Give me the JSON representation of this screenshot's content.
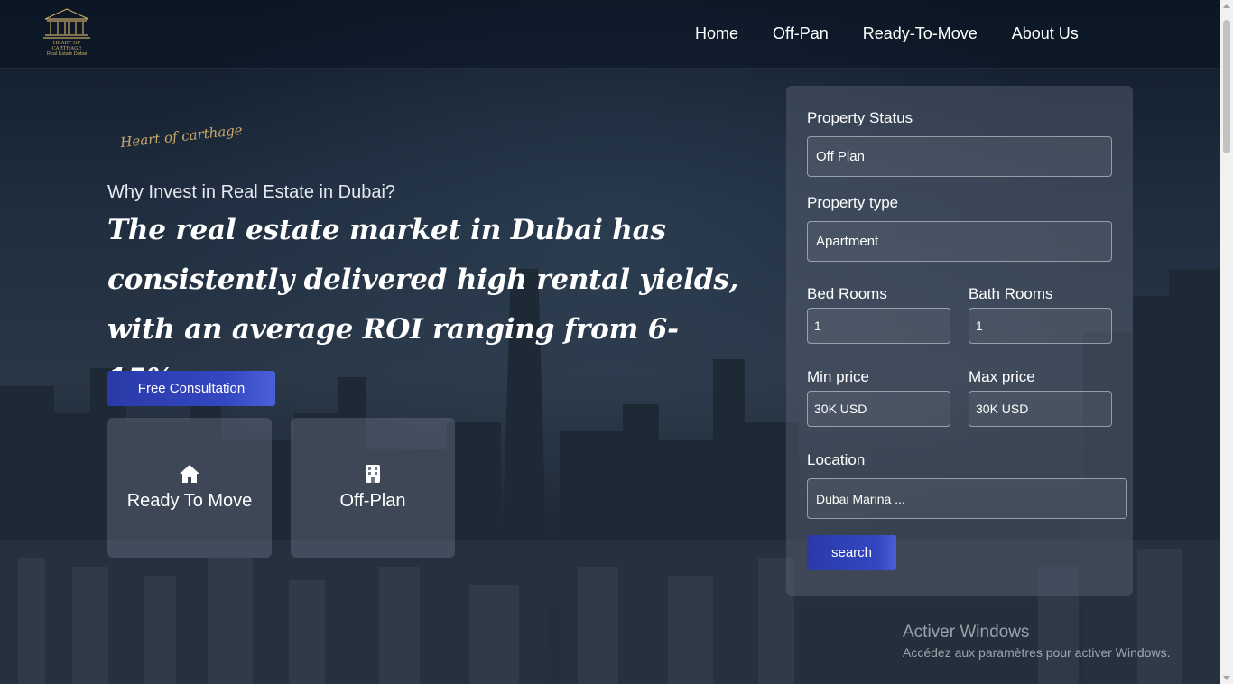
{
  "brand": {
    "logo_line1": "HEART OF CARTHAGE",
    "logo_line2": "Real Estate Dubai",
    "signature": "Heart of carthage"
  },
  "nav": {
    "items": [
      "Home",
      "Off-Pan",
      "Ready-To-Move",
      "About Us"
    ]
  },
  "hero": {
    "kicker": "Why Invest in Real Estate in Dubai?",
    "headline": "The real estate market in Dubai has consistently delivered high rental yields, with an average ROI ranging from 6-15%.",
    "cta_label": "Free Consultation",
    "cards": [
      {
        "label": "Ready To Move",
        "icon": "home-icon"
      },
      {
        "label": "Off-Plan",
        "icon": "building-icon"
      }
    ]
  },
  "search": {
    "status_label": "Property Status",
    "status_value": "Off Plan",
    "type_label": "Property type",
    "type_value": "Apartment",
    "bed_label": "Bed Rooms",
    "bed_value": "1",
    "bath_label": "Bath Rooms",
    "bath_value": "1",
    "min_label": "Min price",
    "min_value": "30K USD",
    "max_label": "Max price",
    "max_value": "30K USD",
    "location_label": "Location",
    "location_value": "Dubai Marina ...",
    "button_label": "search"
  },
  "watermark": {
    "title": "Activer Windows",
    "subtitle": "Accédez aux paramètres pour activer Windows."
  },
  "colors": {
    "accent": "#3447c2",
    "gold": "#c9a86a"
  }
}
